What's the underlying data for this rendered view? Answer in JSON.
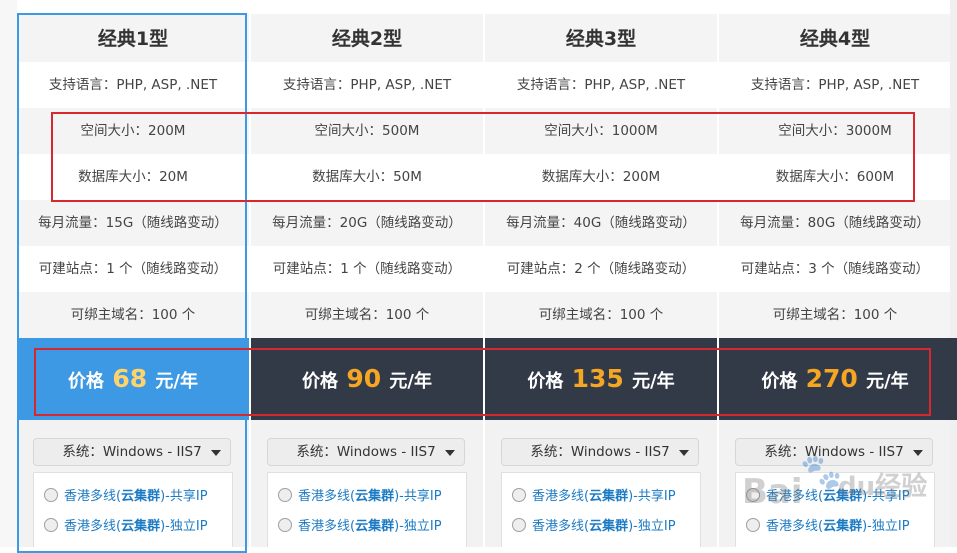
{
  "plans": [
    {
      "name": "经典1型",
      "language": "支持语言：PHP, ASP, .NET",
      "space": "空间大小：200M",
      "database": "数据库大小：20M",
      "traffic": "每月流量：15G（随线路变动）",
      "sites": "可建站点：1 个（随线路变动）",
      "domains": "可绑主域名：100 个",
      "price_prefix": "价格",
      "price_value": "68",
      "price_suffix": "元/年",
      "system": "系统：Windows - IIS7",
      "option1_prefix": "香港多线(",
      "option1_bold": "云集群",
      "option1_suffix": ")-共享IP",
      "option2_prefix": "香港多线(",
      "option2_bold": "云集群",
      "option2_suffix": ")-独立IP"
    },
    {
      "name": "经典2型",
      "language": "支持语言：PHP, ASP, .NET",
      "space": "空间大小：500M",
      "database": "数据库大小：50M",
      "traffic": "每月流量：20G（随线路变动）",
      "sites": "可建站点：1 个（随线路变动）",
      "domains": "可绑主域名：100 个",
      "price_prefix": "价格",
      "price_value": "90",
      "price_suffix": "元/年",
      "system": "系统：Windows - IIS7",
      "option1_prefix": "香港多线(",
      "option1_bold": "云集群",
      "option1_suffix": ")-共享IP",
      "option2_prefix": "香港多线(",
      "option2_bold": "云集群",
      "option2_suffix": ")-独立IP"
    },
    {
      "name": "经典3型",
      "language": "支持语言：PHP, ASP, .NET",
      "space": "空间大小：1000M",
      "database": "数据库大小：200M",
      "traffic": "每月流量：40G（随线路变动）",
      "sites": "可建站点：2 个（随线路变动）",
      "domains": "可绑主域名：100 个",
      "price_prefix": "价格",
      "price_value": "135",
      "price_suffix": "元/年",
      "system": "系统：Windows - IIS7",
      "option1_prefix": "香港多线(",
      "option1_bold": "云集群",
      "option1_suffix": ")-共享IP",
      "option2_prefix": "香港多线(",
      "option2_bold": "云集群",
      "option2_suffix": ")-独立IP"
    },
    {
      "name": "经典4型",
      "language": "支持语言：PHP, ASP, .NET",
      "space": "空间大小：3000M",
      "database": "数据库大小：600M",
      "traffic": "每月流量：80G（随线路变动）",
      "sites": "可建站点：3 个（随线路变动）",
      "domains": "可绑主域名：100 个",
      "price_prefix": "价格",
      "price_value": "270",
      "price_suffix": "元/年",
      "system": "系统：Windows - IIS7",
      "option1_prefix": "香港多线(",
      "option1_bold": "云集群",
      "option1_suffix": ")-共享IP",
      "option2_prefix": "香港多线(",
      "option2_bold": "云集群",
      "option2_suffix": ")-独立IP"
    }
  ],
  "watermark": {
    "brand": "Bai",
    "paw": "du",
    "text": "经验"
  },
  "colors": {
    "accent": "#3d99e3",
    "price_dark": "#323a48",
    "price_number": "#f5a623",
    "highlight_box": "#d6282e",
    "link": "#1d7bc4"
  }
}
